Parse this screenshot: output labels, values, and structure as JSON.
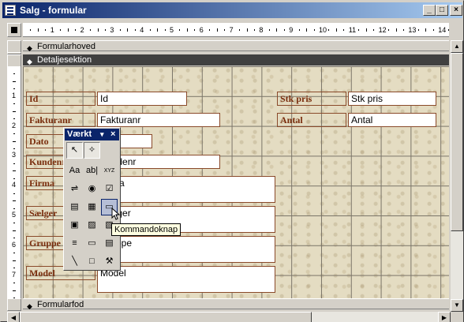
{
  "window": {
    "title": "Salg - formular",
    "min_glyph": "_",
    "max_glyph": "□",
    "close_glyph": "×"
  },
  "ruler": {
    "horizontal_numbers": [
      "1",
      "2",
      "3",
      "4",
      "5",
      "6",
      "7",
      "8",
      "9",
      "10",
      "11",
      "12",
      "13",
      "14"
    ],
    "vertical_numbers": [
      "1",
      "2",
      "3",
      "4",
      "5",
      "6",
      "7"
    ]
  },
  "sections": {
    "header": "Formularhoved",
    "detail": "Detaljesektion",
    "footer": "Formularfod"
  },
  "fields": [
    {
      "label": "Id",
      "value": "Id"
    },
    {
      "label": "Fakturanr",
      "value": "Fakturanr"
    },
    {
      "label": "Dato",
      "value": "Dato"
    },
    {
      "label": "Kundenr",
      "value": "Kundenr"
    },
    {
      "label": "Firma",
      "value": "Firma"
    },
    {
      "label": "Sælger",
      "value": "Sælger"
    },
    {
      "label": "Gruppe",
      "value": "Gruppe"
    },
    {
      "label": "Model",
      "value": "Model"
    },
    {
      "label": "Stk pris",
      "value": "Stk pris"
    },
    {
      "label": "Antal",
      "value": "Antal"
    }
  ],
  "toolbox": {
    "title": "Værkt",
    "drop_glyph": "▾",
    "close_glyph": "×",
    "tools": [
      {
        "name": "select-objects-icon",
        "glyph": "↖"
      },
      {
        "name": "control-wizards-icon",
        "glyph": "✧"
      },
      {
        "name": "label-tool-icon",
        "glyph": "Aa"
      },
      {
        "name": "textbox-tool-icon",
        "glyph": "ab|"
      },
      {
        "name": "option-group-tool-icon",
        "glyph": "XYZ"
      },
      {
        "name": "toggle-button-tool-icon",
        "glyph": "⇌"
      },
      {
        "name": "option-button-tool-icon",
        "glyph": "◉"
      },
      {
        "name": "checkbox-tool-icon",
        "glyph": "☑"
      },
      {
        "name": "combobox-tool-icon",
        "glyph": "▤"
      },
      {
        "name": "listbox-tool-icon",
        "glyph": "▦"
      },
      {
        "name": "command-button-tool-icon",
        "glyph": "▭"
      },
      {
        "name": "image-tool-icon",
        "glyph": "▣"
      },
      {
        "name": "unbound-object-frame-tool-icon",
        "glyph": "▨"
      },
      {
        "name": "bound-object-frame-tool-icon",
        "glyph": "▧"
      },
      {
        "name": "page-break-tool-icon",
        "glyph": "≡"
      },
      {
        "name": "tab-control-tool-icon",
        "glyph": "▭"
      },
      {
        "name": "subform-tool-icon",
        "glyph": "▤"
      },
      {
        "name": "line-tool-icon",
        "glyph": "╲"
      },
      {
        "name": "rectangle-tool-icon",
        "glyph": "□"
      },
      {
        "name": "more-controls-tool-icon",
        "glyph": "⚒"
      }
    ]
  },
  "tooltip": "Kommandoknap"
}
